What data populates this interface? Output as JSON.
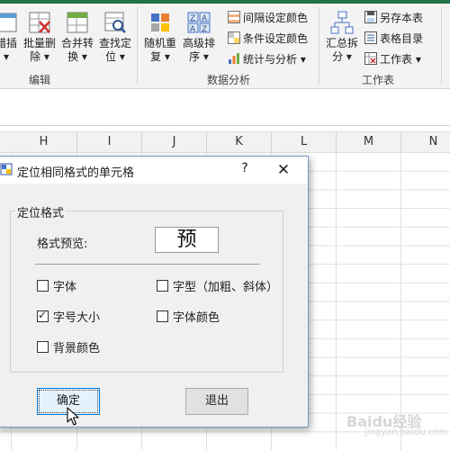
{
  "ribbon": {
    "edit_group": {
      "label": "编辑",
      "buttons": [
        {
          "label": "错插",
          "sub": "▾"
        },
        {
          "label": "批量删",
          "sub": "除 ▾"
        },
        {
          "label": "合并转",
          "sub": "换 ▾"
        },
        {
          "label": "查找定",
          "sub": "位 ▾"
        }
      ]
    },
    "analysis_group": {
      "label": "数据分析",
      "buttons": [
        {
          "label": "随机重",
          "sub": "复 ▾"
        },
        {
          "label": "高级排",
          "sub": "序 ▾"
        }
      ],
      "small_items": [
        "间隔设定颜色",
        "条件设定颜色",
        "统计与分析 ▾"
      ]
    },
    "sheet_group": {
      "label": "工作表",
      "buttons": [
        {
          "label": "汇总拆",
          "sub": "分 ▾"
        }
      ],
      "small_items": [
        "另存本表",
        "表格目录",
        "工作表 ▾"
      ]
    }
  },
  "columns": [
    "H",
    "I",
    "J",
    "K",
    "L",
    "M",
    "N"
  ],
  "dialog": {
    "title": "定位相同格式的单元格",
    "help": "?",
    "close": "✕",
    "group_label": "定位格式",
    "preview_label": "格式预览:",
    "preview_text": "预",
    "checkboxes": [
      {
        "label": "字体",
        "checked": false
      },
      {
        "label": "字型（加粗、斜体）",
        "checked": false
      },
      {
        "label": "字号大小",
        "checked": true
      },
      {
        "label": "字体颜色",
        "checked": false
      },
      {
        "label": "背景颜色",
        "checked": false
      }
    ],
    "ok_label": "确定",
    "cancel_label": "退出"
  },
  "watermark": {
    "text": "Baidu经验",
    "sub": "jingyan.baidu.com"
  }
}
